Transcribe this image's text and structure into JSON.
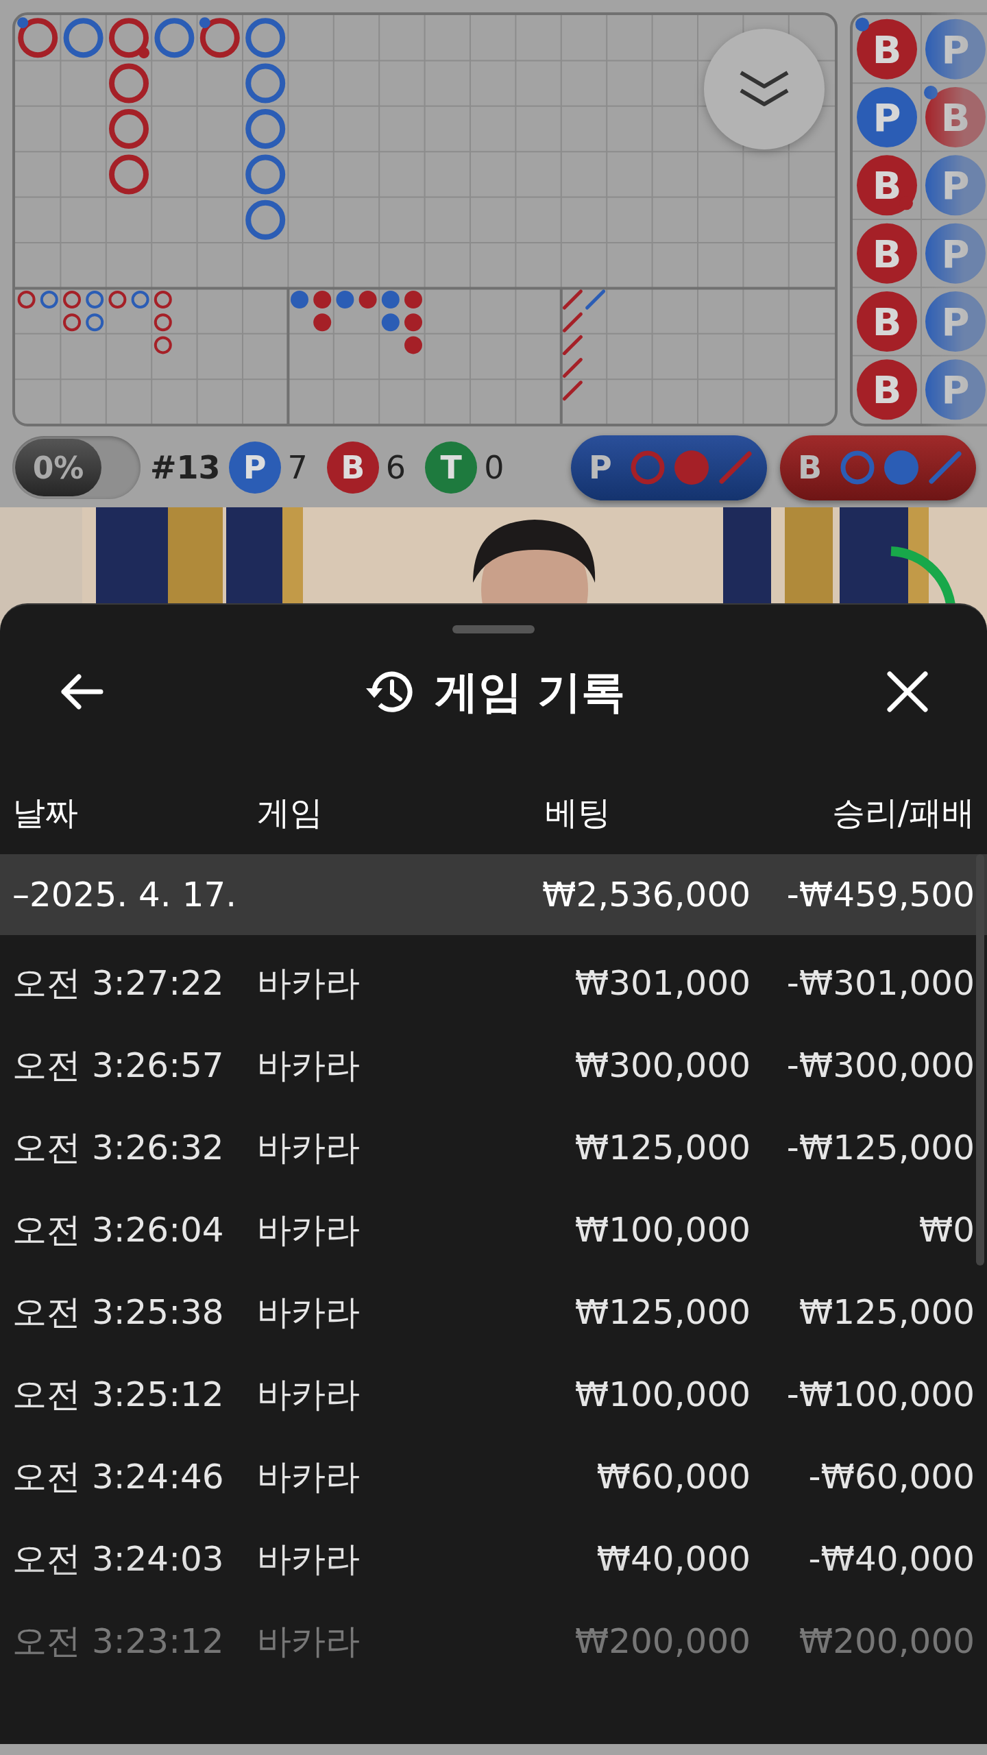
{
  "scoreboard": {
    "big_road": [
      [
        {
          "kind": "banker",
          "player_pair": true
        }
      ],
      [
        {
          "kind": "player"
        }
      ],
      [
        {
          "kind": "banker",
          "banker_pair": true
        },
        {
          "kind": "banker"
        },
        {
          "kind": "banker"
        },
        {
          "kind": "banker"
        }
      ],
      [
        {
          "kind": "player"
        }
      ],
      [
        {
          "kind": "banker",
          "player_pair": true
        }
      ],
      [
        {
          "kind": "player"
        },
        {
          "kind": "player"
        },
        {
          "kind": "player"
        },
        {
          "kind": "player"
        },
        {
          "kind": "player"
        }
      ]
    ],
    "big_eye_road": [
      [
        {
          "color": "#a52027"
        }
      ],
      [
        {
          "color": "#2b5db5"
        }
      ],
      [
        {
          "color": "#a52027"
        },
        {
          "color": "#a52027"
        }
      ],
      [
        {
          "color": "#2b5db5"
        },
        {
          "color": "#2b5db5"
        }
      ],
      [
        {
          "color": "#a52027"
        }
      ],
      [
        {
          "color": "#2b5db5"
        }
      ],
      [
        {
          "color": "#a52027"
        },
        {
          "color": "#a52027"
        },
        {
          "color": "#a52027"
        }
      ]
    ],
    "small_road": [
      [
        {
          "color": "#2b5db5"
        }
      ],
      [
        {
          "color": "#a52027"
        },
        {
          "color": "#a52027"
        }
      ],
      [
        {
          "color": "#2b5db5"
        }
      ],
      [
        {
          "color": "#a52027"
        }
      ],
      [
        {
          "color": "#2b5db5"
        },
        {
          "color": "#2b5db5"
        }
      ],
      [
        {
          "color": "#a52027"
        },
        {
          "color": "#a52027"
        },
        {
          "color": "#a52027"
        }
      ]
    ],
    "cockroach_road": [
      [
        {
          "color": "#a52027"
        },
        {
          "color": "#a52027"
        },
        {
          "color": "#a52027"
        },
        {
          "color": "#a52027"
        },
        {
          "color": "#a52027"
        }
      ],
      [
        {
          "color": "#2b5db5"
        }
      ]
    ],
    "bead_road": [
      [
        {
          "label": "B",
          "kind": "banker",
          "player_pair": true
        },
        {
          "label": "P",
          "kind": "player"
        },
        {
          "label": "B",
          "kind": "banker",
          "banker_pair": true
        },
        {
          "label": "B",
          "kind": "banker"
        },
        {
          "label": "B",
          "kind": "banker"
        },
        {
          "label": "B",
          "kind": "banker"
        }
      ],
      [
        {
          "label": "P",
          "kind": "player"
        },
        {
          "label": "B",
          "kind": "banker",
          "player_pair": true
        },
        {
          "label": "P",
          "kind": "player"
        },
        {
          "label": "P",
          "kind": "player"
        },
        {
          "label": "P",
          "kind": "player"
        },
        {
          "label": "P",
          "kind": "player"
        }
      ]
    ]
  },
  "stats": {
    "toggle": {
      "label": "0%",
      "on": false
    },
    "round": "#13",
    "counts": [
      {
        "kind": "player",
        "letter": "P",
        "count": "7"
      },
      {
        "kind": "banker",
        "letter": "B",
        "count": "6"
      },
      {
        "kind": "tie",
        "letter": "T",
        "count": "0"
      }
    ],
    "ask_buttons": [
      {
        "kind": "player",
        "letter": "P"
      },
      {
        "kind": "banker",
        "letter": "B"
      }
    ]
  },
  "history": {
    "title": "게임 기록",
    "columns": [
      "날짜",
      "게임",
      "베팅",
      "승리/패배"
    ],
    "group": {
      "date": "–2025. 4. 17.",
      "bet": "₩2,536,000",
      "result": "-₩459,500"
    },
    "rows": [
      {
        "time": "오전 3:27:22",
        "game": "바카라",
        "bet": "₩301,000",
        "result": "-₩301,000"
      },
      {
        "time": "오전 3:26:57",
        "game": "바카라",
        "bet": "₩300,000",
        "result": "-₩300,000"
      },
      {
        "time": "오전 3:26:32",
        "game": "바카라",
        "bet": "₩125,000",
        "result": "-₩125,000"
      },
      {
        "time": "오전 3:26:04",
        "game": "바카라",
        "bet": "₩100,000",
        "result": "₩0"
      },
      {
        "time": "오전 3:25:38",
        "game": "바카라",
        "bet": "₩125,000",
        "result": "₩125,000"
      },
      {
        "time": "오전 3:25:12",
        "game": "바카라",
        "bet": "₩100,000",
        "result": "-₩100,000"
      },
      {
        "time": "오전 3:24:46",
        "game": "바카라",
        "bet": "₩60,000",
        "result": "-₩60,000"
      },
      {
        "time": "오전 3:24:03",
        "game": "바카라",
        "bet": "₩40,000",
        "result": "-₩40,000"
      },
      {
        "time": "오전 3:23:12",
        "game": "바카라",
        "bet": "₩200,000",
        "result": "₩200,000"
      }
    ]
  }
}
